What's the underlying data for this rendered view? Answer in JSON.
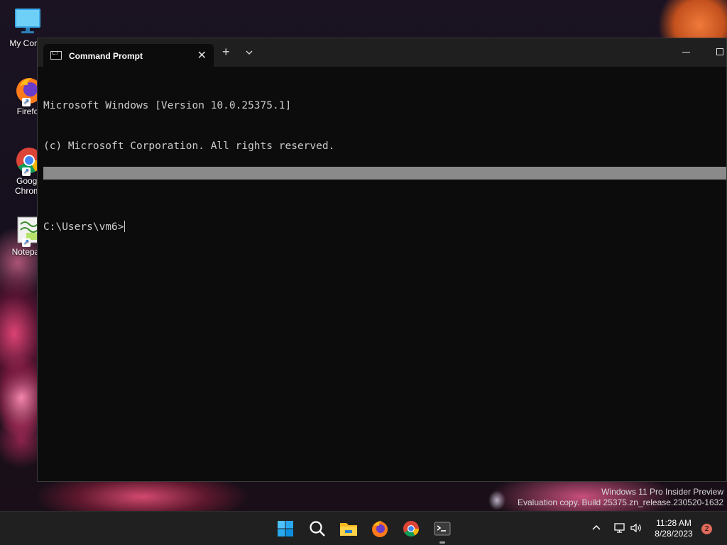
{
  "desktop": {
    "icons": [
      {
        "label": "My Comp",
        "icon": "monitor-icon"
      },
      {
        "label": "Firefo",
        "icon": "firefox-icon"
      },
      {
        "label": "Googl Chrom",
        "icon": "chrome-icon"
      },
      {
        "label": "Notepac",
        "icon": "notepad-icon"
      }
    ],
    "watermark": {
      "line1": "Windows 11 Pro Insider Preview",
      "line2": "Evaluation copy. Build 25375.zn_release.230520-1632"
    }
  },
  "terminal": {
    "tab_title": "Command Prompt",
    "tab_icon": "cmd-icon",
    "lines": [
      "Microsoft Windows [Version 10.0.25375.1]",
      "(c) Microsoft Corporation. All rights reserved.",
      "",
      "C:\\Users\\vm6>"
    ]
  },
  "taskbar": {
    "apps": [
      {
        "name": "Start",
        "icon": "windows-start-icon"
      },
      {
        "name": "Search",
        "icon": "search-icon"
      },
      {
        "name": "File Explorer",
        "icon": "folder-icon"
      },
      {
        "name": "Firefox",
        "icon": "firefox-icon"
      },
      {
        "name": "Chrome",
        "icon": "chrome-icon"
      },
      {
        "name": "Terminal",
        "icon": "terminal-icon",
        "active": true
      }
    ],
    "clock": {
      "time": "11:28 AM",
      "date": "8/28/2023"
    },
    "notification_count": "2"
  },
  "colors": {
    "console_bg": "#0c0c0c",
    "console_fg": "#cccccc",
    "taskbar_bg": "#202020",
    "windows_blue": "#0078d4"
  }
}
